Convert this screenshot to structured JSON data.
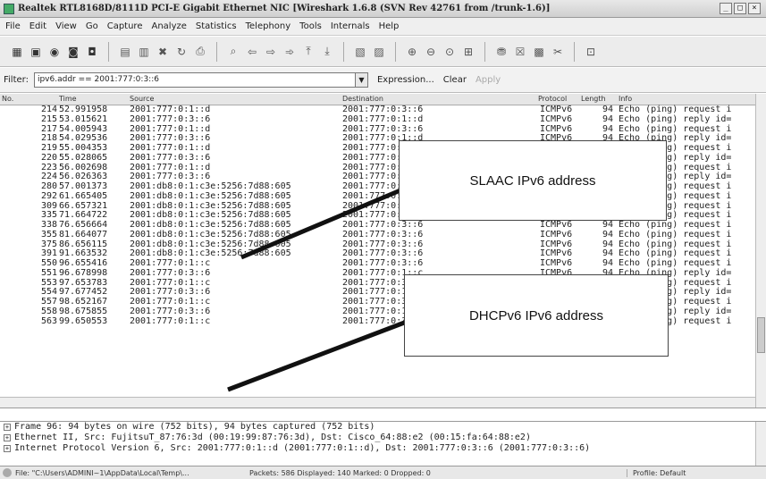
{
  "window": {
    "title": "Realtek RTL8168D/8111D PCI-E Gigabit Ethernet NIC  [Wireshark 1.6.8  (SVN Rev 42761 from /trunk-1.6)]",
    "controls": [
      "_",
      "□",
      "×"
    ]
  },
  "menu": [
    "File",
    "Edit",
    "View",
    "Go",
    "Capture",
    "Analyze",
    "Statistics",
    "Telephony",
    "Tools",
    "Internals",
    "Help"
  ],
  "filter": {
    "label": "Filter:",
    "value": "ipv6.addr == 2001:777:0:3::6",
    "expression_label": "Expression...",
    "clear_label": "Clear",
    "apply_label": "Apply"
  },
  "columns": {
    "no": "No.",
    "time": "Time",
    "source": "Source",
    "destination": "Destination",
    "protocol": "Protocol",
    "length": "Length",
    "info": "Info"
  },
  "packets": [
    {
      "no": "214",
      "time": "52.991958",
      "src": "2001:777:0:1::d",
      "dst": "2001:777:0:3::6",
      "proto": "ICMPv6",
      "len": "94",
      "info": "Echo (ping) request i"
    },
    {
      "no": "215",
      "time": "53.015621",
      "src": "2001:777:0:3::6",
      "dst": "2001:777:0:1::d",
      "proto": "ICMPv6",
      "len": "94",
      "info": "Echo (ping) reply id="
    },
    {
      "no": "217",
      "time": "54.005943",
      "src": "2001:777:0:1::d",
      "dst": "2001:777:0:3::6",
      "proto": "ICMPv6",
      "len": "94",
      "info": "Echo (ping) request i"
    },
    {
      "no": "218",
      "time": "54.029536",
      "src": "2001:777:0:3::6",
      "dst": "2001:777:0:1::d",
      "proto": "ICMPv6",
      "len": "94",
      "info": "Echo (ping) reply id="
    },
    {
      "no": "219",
      "time": "55.004353",
      "src": "2001:777:0:1::d",
      "dst": "2001:777:0:3::6",
      "proto": "ICMPv6",
      "len": "94",
      "info": "Echo (ping) request i"
    },
    {
      "no": "220",
      "time": "55.028065",
      "src": "2001:777:0:3::6",
      "dst": "2001:777:0:1::d",
      "proto": "ICMPv6",
      "len": "94",
      "info": "Echo (ping) reply id="
    },
    {
      "no": "223",
      "time": "56.002698",
      "src": "2001:777:0:1::d",
      "dst": "2001:777:0:3::6",
      "proto": "ICMPv6",
      "len": "94",
      "info": "Echo (ping) request i"
    },
    {
      "no": "224",
      "time": "56.026363",
      "src": "2001:777:0:3::6",
      "dst": "2001:777:0:1::d",
      "proto": "ICMPv6",
      "len": "94",
      "info": "Echo (ping) reply id="
    },
    {
      "no": "280",
      "time": "57.001373",
      "src": "2001:db8:0:1:c3e:5256:7d88:605",
      "dst": "2001:777:0:3::6",
      "proto": "ICMPv6",
      "len": "94",
      "info": "Echo (ping) request i"
    },
    {
      "no": "292",
      "time": "61.665405",
      "src": "2001:db8:0:1:c3e:5256:7d88:605",
      "dst": "2001:777:0:3::6",
      "proto": "ICMPv6",
      "len": "94",
      "info": "Echo (ping) request i"
    },
    {
      "no": "309",
      "time": "66.657321",
      "src": "2001:db8:0:1:c3e:5256:7d88:605",
      "dst": "2001:777:0:3::6",
      "proto": "ICMPv6",
      "len": "94",
      "info": "Echo (ping) request i"
    },
    {
      "no": "335",
      "time": "71.664722",
      "src": "2001:db8:0:1:c3e:5256:7d88:605",
      "dst": "2001:777:0:3::6",
      "proto": "ICMPv6",
      "len": "94",
      "info": "Echo (ping) request i"
    },
    {
      "no": "338",
      "time": "76.656664",
      "src": "2001:db8:0:1:c3e:5256:7d88:605",
      "dst": "2001:777:0:3::6",
      "proto": "ICMPv6",
      "len": "94",
      "info": "Echo (ping) request i"
    },
    {
      "no": "355",
      "time": "81.664077",
      "src": "2001:db8:0:1:c3e:5256:7d88:605",
      "dst": "2001:777:0:3::6",
      "proto": "ICMPv6",
      "len": "94",
      "info": "Echo (ping) request i"
    },
    {
      "no": "375",
      "time": "86.656115",
      "src": "2001:db8:0:1:c3e:5256:7d88:605",
      "dst": "2001:777:0:3::6",
      "proto": "ICMPv6",
      "len": "94",
      "info": "Echo (ping) request i"
    },
    {
      "no": "391",
      "time": "91.663532",
      "src": "2001:db8:0:1:c3e:5256:7d88:605",
      "dst": "2001:777:0:3::6",
      "proto": "ICMPv6",
      "len": "94",
      "info": "Echo (ping) request i"
    },
    {
      "no": "550",
      "time": "96.655416",
      "src": "2001:777:0:1::c",
      "dst": "2001:777:0:3::6",
      "proto": "ICMPv6",
      "len": "94",
      "info": "Echo (ping) request i"
    },
    {
      "no": "551",
      "time": "96.678998",
      "src": "2001:777:0:3::6",
      "dst": "2001:777:0:1::c",
      "proto": "ICMPv6",
      "len": "94",
      "info": "Echo (ping) reply id="
    },
    {
      "no": "553",
      "time": "97.653783",
      "src": "2001:777:0:1::c",
      "dst": "2001:777:0:3::6",
      "proto": "ICMPv6",
      "len": "94",
      "info": "Echo (ping) request i"
    },
    {
      "no": "554",
      "time": "97.677452",
      "src": "2001:777:0:3::6",
      "dst": "2001:777:0:1::c",
      "proto": "ICMPv6",
      "len": "94",
      "info": "Echo (ping) reply id="
    },
    {
      "no": "557",
      "time": "98.652167",
      "src": "2001:777:0:1::c",
      "dst": "2001:777:0:3::6",
      "proto": "ICMPv6",
      "len": "94",
      "info": "Echo (ping) request i"
    },
    {
      "no": "558",
      "time": "98.675855",
      "src": "2001:777:0:3::6",
      "dst": "2001:777:0:1::c",
      "proto": "ICMPv6",
      "len": "94",
      "info": "Echo (ping) reply id="
    },
    {
      "no": "563",
      "time": "99.650553",
      "src": "2001:777:0:1::c",
      "dst": "2001:777:0:3::6",
      "proto": "ICMPv6",
      "len": "94",
      "info": "Echo (ping) request i"
    }
  ],
  "callouts": {
    "slaac": "SLAAC IPv6 address",
    "dhcp": "DHCPv6 IPv6 address"
  },
  "details": [
    "Frame 96: 94 bytes on wire (752 bits), 94 bytes captured (752 bits)",
    "Ethernet II, Src: FujitsuT_87:76:3d (00:19:99:87:76:3d), Dst: Cisco_64:88:e2 (00:15:fa:64:88:e2)",
    "Internet Protocol Version 6, Src: 2001:777:0:1::d (2001:777:0:1::d), Dst: 2001:777:0:3::6 (2001:777:0:3::6)"
  ],
  "status": {
    "file": "File: \"C:\\Users\\ADMINI~1\\AppData\\Local\\Temp\\...",
    "packets": "Packets: 586 Displayed: 140 Marked: 0 Dropped: 0",
    "profile": "Profile: Default"
  }
}
